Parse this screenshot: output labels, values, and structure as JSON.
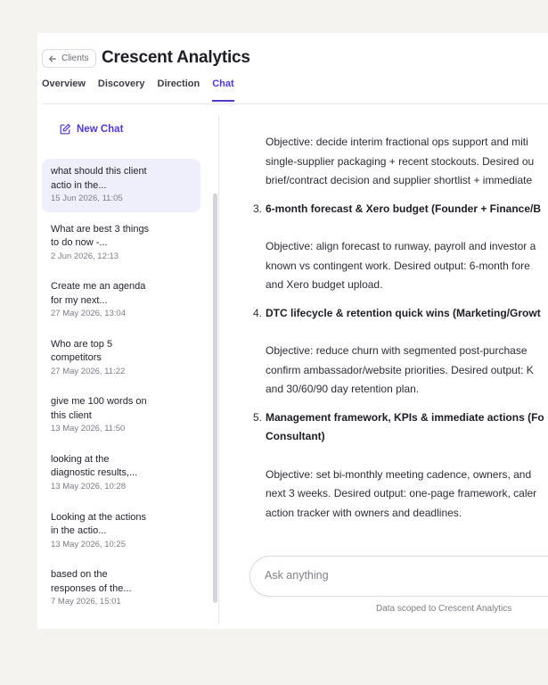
{
  "header": {
    "back_label": "Clients",
    "client_name": "Crescent Analytics"
  },
  "tabs": [
    {
      "label": "Overview"
    },
    {
      "label": "Discovery"
    },
    {
      "label": "Direction"
    },
    {
      "label": "Chat",
      "active": true
    }
  ],
  "sidebar": {
    "new_chat_label": "New Chat",
    "chats": [
      {
        "title": "what should this client actio in the...",
        "date": "15 Jun 2026, 11:05",
        "active": true
      },
      {
        "title": "What are best 3 things to do now -...",
        "date": "2 Jun 2026, 12:13"
      },
      {
        "title": "Create me an agenda for my next...",
        "date": "27 May 2026, 13:04"
      },
      {
        "title": "Who are top 5 competitors",
        "date": "27 May 2026, 11:22"
      },
      {
        "title": "give me 100 words on this client",
        "date": "13 May 2026, 11:50"
      },
      {
        "title": "looking at the diagnostic results,...",
        "date": "13 May 2026, 10:28"
      },
      {
        "title": "Looking at the actions in the actio...",
        "date": "13 May 2026, 10:25"
      },
      {
        "title": "based on the responses of the...",
        "date": "7 May 2026, 15:01"
      }
    ]
  },
  "message": {
    "block2_objective": [
      "Objective: decide interim fractional ops support and miti",
      "single-supplier packaging + recent stockouts. Desired ou",
      "brief/contract decision and supplier shortlist + immediate"
    ],
    "item3": {
      "num": "3.",
      "title": "6-month forecast & Xero budget (Founder + Finance/B"
    },
    "item3_objective": [
      "Objective: align forecast to runway, payroll and investor a",
      "known vs contingent work. Desired output: 6-month fore",
      "and Xero budget upload."
    ],
    "item4": {
      "num": "4.",
      "title": "DTC lifecycle & retention quick wins (Marketing/Growt"
    },
    "item4_objective": [
      "Objective: reduce churn with segmented post-purchase",
      "confirm ambassador/website priorities. Desired output: K",
      "and 30/60/90 day retention plan."
    ],
    "item5": {
      "num": "5.",
      "title_line1": "Management framework, KPIs & immediate actions (Fo",
      "title_line2": "Consultant)"
    },
    "item5_objective": [
      "Objective: set bi-monthly meeting cadence, owners, and",
      "next 3 weeks. Desired output: one-page framework, caler",
      "action tracker with owners and deadlines."
    ]
  },
  "composer": {
    "placeholder": "Ask anything",
    "scope_note": "Data scoped to Crescent Analytics"
  }
}
